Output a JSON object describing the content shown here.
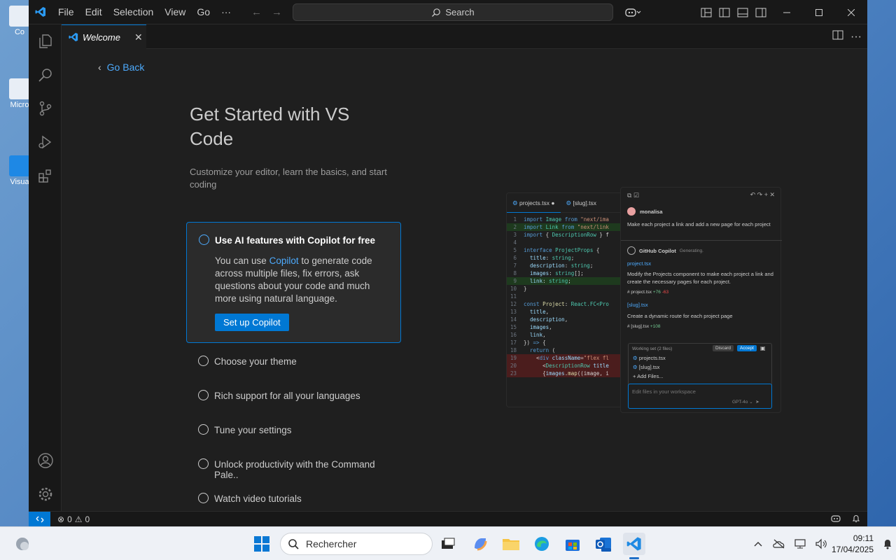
{
  "desktop": {
    "icons": [
      {
        "label": "Co"
      },
      {
        "label": "Micro"
      },
      {
        "label": "Visua"
      }
    ]
  },
  "titlebar": {
    "menu": [
      "File",
      "Edit",
      "Selection",
      "View",
      "Go",
      "···"
    ],
    "search_label": "Search"
  },
  "tab": {
    "label": "Welcome"
  },
  "welcome": {
    "go_back": "Go Back",
    "title": "Get Started with VS Code",
    "subtitle": "Customize your editor, learn the basics, and start coding",
    "active_step": {
      "title": "Use AI features with Copilot for free",
      "desc_prefix": "You can use ",
      "desc_link": "Copilot",
      "desc_suffix": " to generate code across multiple files, fix errors, ask questions about your code and much more using natural language.",
      "button": "Set up Copilot"
    },
    "steps": [
      "Choose your theme",
      "Rich support for all your languages",
      "Tune your settings",
      "Unlock productivity with the Command Pale..",
      "Watch video tutorials"
    ]
  },
  "illustration": {
    "code_tabs": [
      "projects.tsx",
      "[slug].tsx"
    ],
    "chat": {
      "user": "monalisa",
      "user_msg": "Make each project a link and add a new page for each project",
      "assistant": "GitHub Copilot",
      "status": "Generating.",
      "file1": "project.tsx",
      "msg1": "Modify the Projects component to make each project a link and create the necessary pages for each project.",
      "file1_chip": "project.tsx",
      "file1_diff_add": "+76",
      "file1_diff_del": "-63",
      "file2": "[slug].tsx",
      "msg2": "Create a dynamic route for each project page",
      "file2_chip": "[slug].tsx",
      "file2_diff_add": "+108",
      "working_set": "Working set (2 files)",
      "discard": "Discard",
      "accept": "Accept",
      "ws_files": [
        "projects.tsx",
        "[slug].tsx"
      ],
      "add_files": "Add Files...",
      "input_placeholder": "Edit files in your workspace",
      "model": "GPT-4o"
    }
  },
  "statusbar": {
    "errors": "0",
    "warnings": "0"
  },
  "taskbar": {
    "search_placeholder": "Rechercher",
    "time": "09:11",
    "date": "17/04/2025"
  }
}
